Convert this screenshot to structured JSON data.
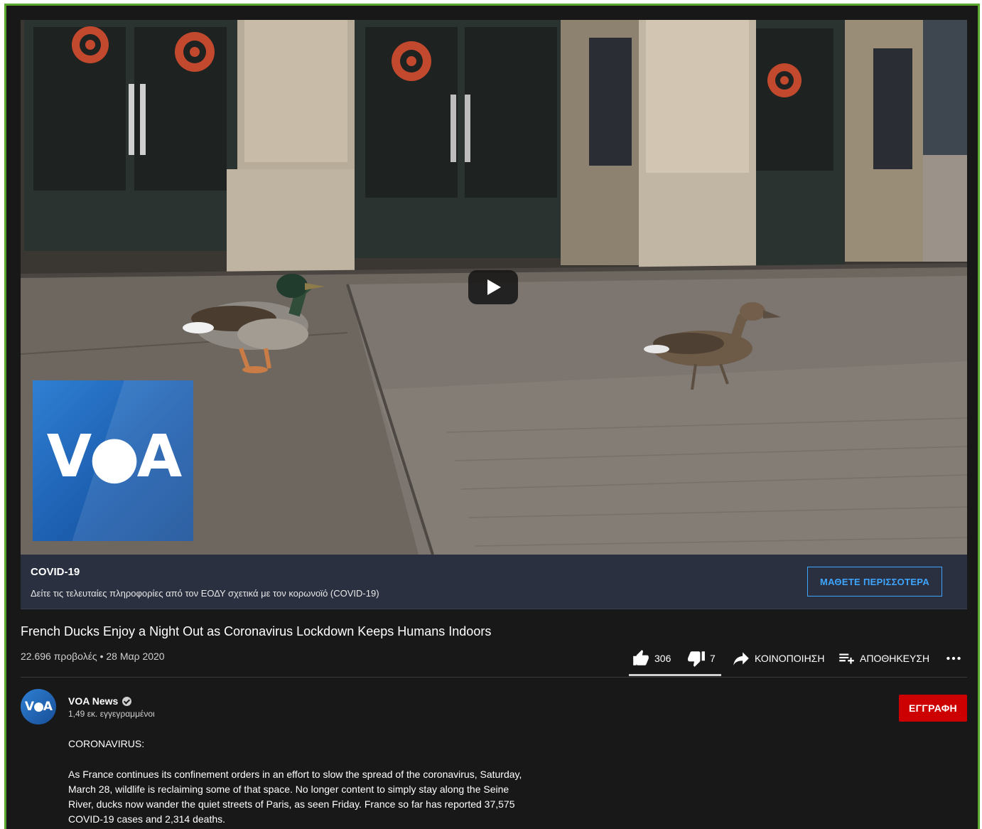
{
  "video": {
    "logo_text": "V●A",
    "play_label": "Play"
  },
  "info_panel": {
    "title": "COVID-19",
    "text": "Δείτε τις τελευταίες πληροφορίες από τον ΕΟΔΥ σχετικά με τον κορωνοϊό (COVID-19)",
    "button_label": "ΜΑΘΕΤΕ ΠΕΡΙΣΣΟΤΕΡΑ",
    "accent": "#3ea6ff"
  },
  "video_title": "French Ducks Enjoy a Night Out as Coronavirus Lockdown Keeps Humans Indoors",
  "meta": {
    "views": "22.696 προβολές",
    "separator": "•",
    "date": "28 Μαρ 2020"
  },
  "actions": {
    "likes": "306",
    "dislikes": "7",
    "share_label": "ΚΟΙΝΟΠΟΙΗΣΗ",
    "save_label": "ΑΠΟΘΗΚΕΥΣΗ",
    "more_icon": "more-horizontal-icon"
  },
  "channel": {
    "avatar_text": "V●A",
    "name": "VOA News",
    "subscribers": "1,49 εκ. εγγεγραμμένοι",
    "subscribe_label": "ΕΓΓΡΑΦΗ",
    "subscribe_color": "#cc0000"
  },
  "description": {
    "heading": "CORONAVIRUS:",
    "body": "As France continues its confinement orders in an effort to slow the spread of the coronavirus, Saturday, March 28, wildlife is reclaiming some of that space. No longer content to simply stay along the Seine River, ducks now wander the quiet streets of Paris, as seen Friday. France so far has reported 37,575 COVID-19 cases and 2,314 deaths."
  },
  "colors": {
    "background": "#181818",
    "frame_border": "#5aa82e"
  }
}
